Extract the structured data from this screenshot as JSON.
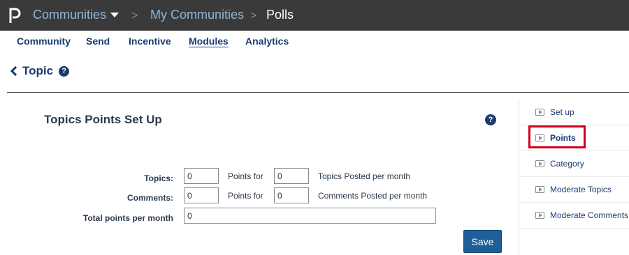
{
  "header": {
    "breadcrumbs": [
      "Communities",
      "My Communities",
      "Polls"
    ],
    "separator": ">"
  },
  "tabs": [
    {
      "label": "Community"
    },
    {
      "label": "Send"
    },
    {
      "label": "Incentive"
    },
    {
      "label": "Modules",
      "active": true
    },
    {
      "label": "Analytics"
    }
  ],
  "page": {
    "title": "Topic"
  },
  "panel": {
    "title": "Topics Points Set Up",
    "rows": {
      "topics": {
        "label": "Topics:",
        "points": "0",
        "points_for_label": "Points for",
        "count": "0",
        "suffix": "Topics Posted per month"
      },
      "comments": {
        "label": "Comments:",
        "points": "0",
        "points_for_label": "Points for",
        "count": "0",
        "suffix": "Comments Posted per month"
      },
      "total": {
        "label": "Total points per month",
        "value": "0"
      }
    },
    "save_label": "Save"
  },
  "sidebar": {
    "items": [
      {
        "label": "Set up"
      },
      {
        "label": "Points",
        "active": true
      },
      {
        "label": "Category"
      },
      {
        "label": "Moderate Topics"
      },
      {
        "label": "Moderate Comments"
      }
    ]
  },
  "colors": {
    "topbar": "#3a3a3a",
    "link": "#1b3b6f",
    "button": "#1f5f99",
    "highlight": "#d0021b"
  }
}
